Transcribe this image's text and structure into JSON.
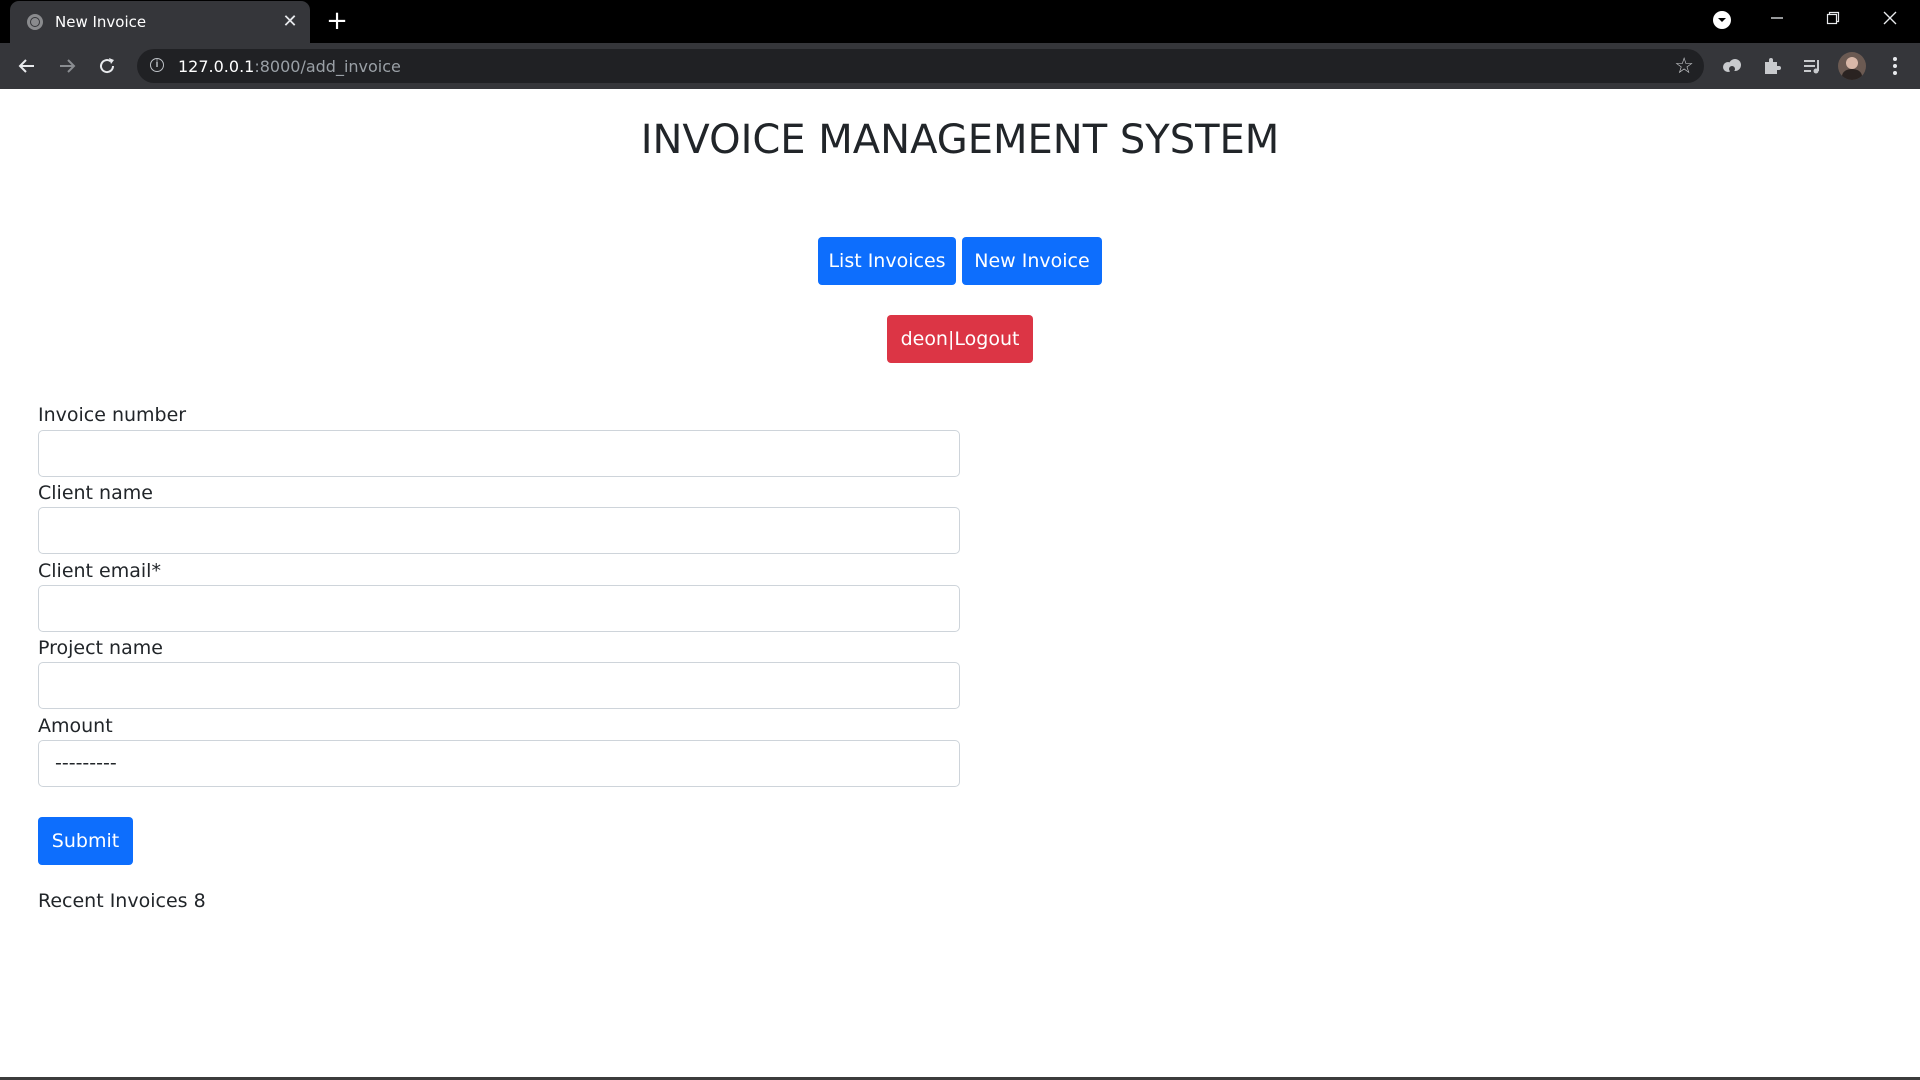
{
  "browser": {
    "tab_title": "New Invoice",
    "tab_close_icon": "close-icon",
    "new_tab_icon": "plus-icon",
    "url_host": "127.0.0.1",
    "url_path": ":8000/add_invoice",
    "window_controls": [
      "minimize-icon",
      "restore-icon",
      "close-icon"
    ],
    "toolbar_icons": [
      "back-icon",
      "forward-icon",
      "reload-icon",
      "info-icon",
      "star-icon",
      "extension-icon",
      "puzzle-icon",
      "media-icon",
      "avatar",
      "menu-icon"
    ]
  },
  "page": {
    "title": "INVOICE MANAGEMENT SYSTEM",
    "nav": {
      "list_label": "List Invoices",
      "new_label": "New Invoice",
      "logout_label": "deon|Logout"
    },
    "form": {
      "fields": [
        {
          "label": "Invoice number",
          "value": ""
        },
        {
          "label": "Client name",
          "value": ""
        },
        {
          "label": "Client email*",
          "value": ""
        },
        {
          "label": "Project name",
          "value": ""
        },
        {
          "label": "Amount",
          "value": "---------"
        }
      ],
      "submit_label": "Submit"
    },
    "recent_label": "Recent Invoices 8"
  },
  "colors": {
    "primary": "#0d6efd",
    "danger": "#dc3545",
    "text": "#212529",
    "border": "#ced4da"
  }
}
